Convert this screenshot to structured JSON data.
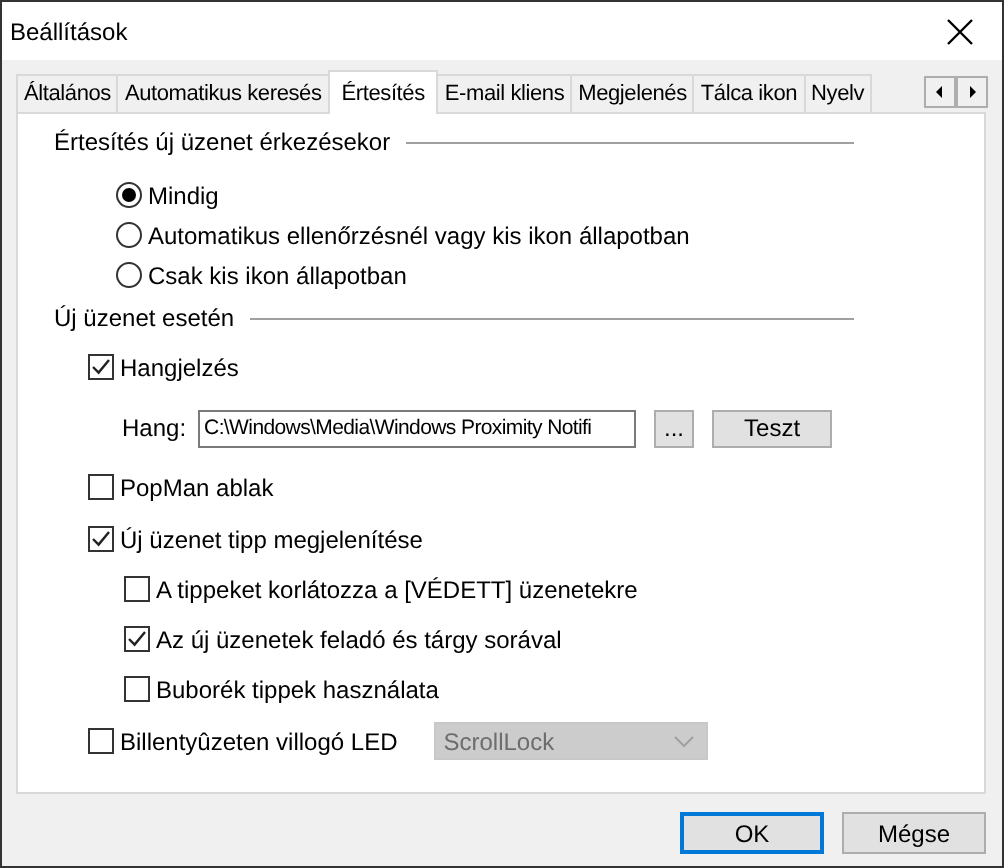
{
  "window": {
    "title": "Beállítások"
  },
  "tabs": [
    {
      "label": "Általános",
      "selected": false
    },
    {
      "label": "Automatikus keresés",
      "selected": false
    },
    {
      "label": "Értesítés",
      "selected": true
    },
    {
      "label": "E-mail kliens",
      "selected": false
    },
    {
      "label": "Megjelenés",
      "selected": false
    },
    {
      "label": "Tálca ikon",
      "selected": false
    },
    {
      "label": "Nyelv",
      "selected": false
    }
  ],
  "notify_section": {
    "heading": "Értesítés új üzenet érkezésekor",
    "options": [
      {
        "label": "Mindig",
        "selected": true
      },
      {
        "label": "Automatikus ellenőrzésnél vagy kis ikon állapotban",
        "selected": false
      },
      {
        "label": "Csak kis ikon állapotban",
        "selected": false
      }
    ]
  },
  "new_message_section": {
    "heading": "Új üzenet  esetén",
    "items": [
      {
        "kind": "checkbox",
        "label": "Hangjelzés",
        "checked": true
      },
      {
        "kind": "sound",
        "label": "Hang:",
        "value": "C:\\Windows\\Media\\Windows Proximity Notifi",
        "browse": "...",
        "test": "Teszt"
      },
      {
        "kind": "checkbox",
        "label": "PopMan ablak",
        "checked": false
      },
      {
        "kind": "checkbox",
        "label": "Új üzenet tipp megjelenítése",
        "checked": true,
        "children": [
          {
            "label": "A tippeket korlátozza a [VÉDETT] üzenetekre",
            "checked": false
          },
          {
            "label": "Az új üzenetek feladó és tárgy sorával",
            "checked": true
          },
          {
            "label": "Buborék tippek használata",
            "checked": false
          }
        ]
      },
      {
        "kind": "led",
        "label": "Billentyûzeten villogó LED",
        "checked": false,
        "dropdown": {
          "value": "ScrollLock",
          "disabled": true
        }
      }
    ]
  },
  "buttons": [
    {
      "label": "OK",
      "default": true
    },
    {
      "label": "Mégse",
      "default": false
    }
  ]
}
